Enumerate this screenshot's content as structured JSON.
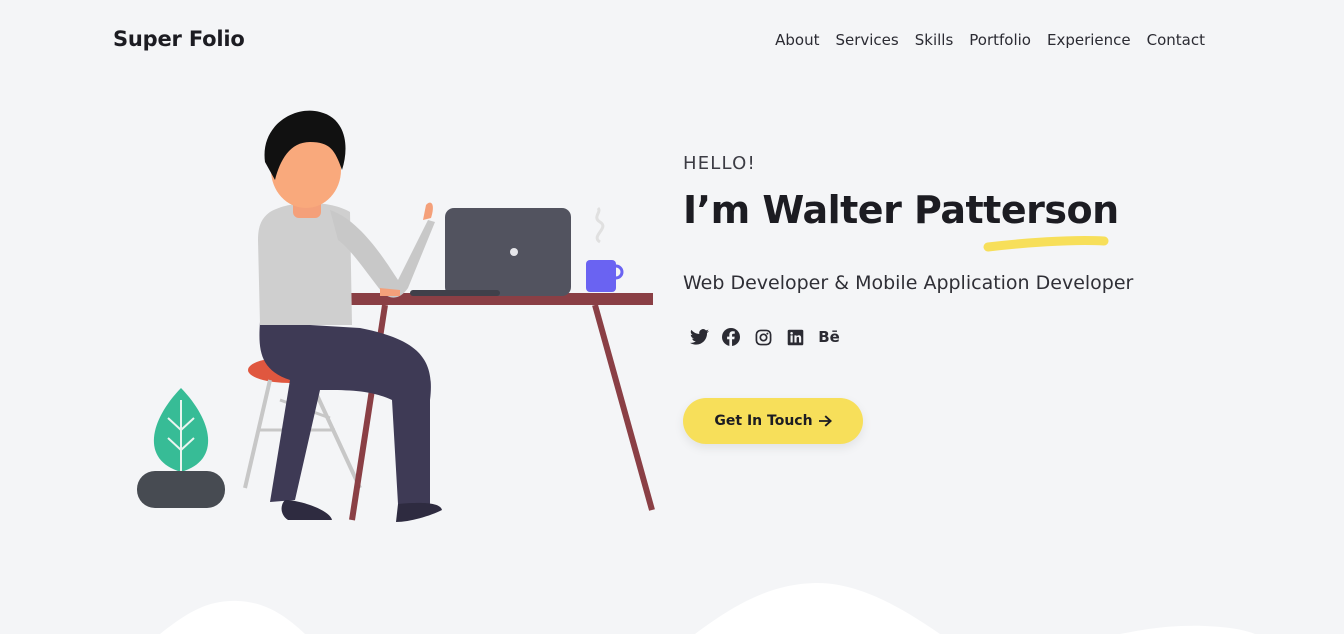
{
  "header": {
    "brand": "Super Folio",
    "nav": [
      "About",
      "Services",
      "Skills",
      "Portfolio",
      "Experience",
      "Contact"
    ]
  },
  "hero": {
    "greeting": "HELLO!",
    "name": "I’m Walter Patterson",
    "role": "Web Developer & Mobile Application Developer",
    "cta_label": "Get In Touch",
    "cta_icon": "arrow-right-icon",
    "socials": [
      {
        "icon": "twitter-icon"
      },
      {
        "icon": "facebook-icon"
      },
      {
        "icon": "instagram-icon"
      },
      {
        "icon": "linkedin-icon"
      },
      {
        "icon": "behance-icon",
        "text": "Bē"
      }
    ],
    "illustration": "developer-at-desk-illustration"
  },
  "colors": {
    "background": "#f4f5f7",
    "accent_yellow": "#f7df5a",
    "text_dark": "#1c1c22"
  }
}
